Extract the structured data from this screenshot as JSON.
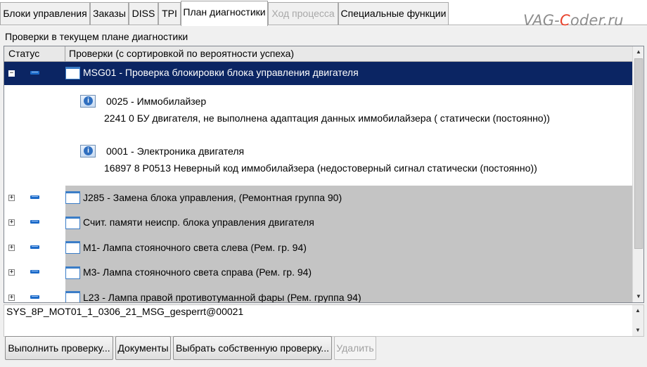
{
  "tabs": [
    {
      "label": "Блоки управления",
      "state": "normal"
    },
    {
      "label": "Заказы",
      "state": "normal"
    },
    {
      "label": "DISS",
      "state": "normal"
    },
    {
      "label": "TPI",
      "state": "normal"
    },
    {
      "label": "План диагностики",
      "state": "active"
    },
    {
      "label": "Ход процесса",
      "state": "disabled"
    },
    {
      "label": "Специальные функции",
      "state": "normal"
    }
  ],
  "watermark": {
    "prefix": "VAG-",
    "accent": "C",
    "suffix": "oder.ru"
  },
  "plan": {
    "section_label": "Проверки в текущем плане диагностики",
    "columns": {
      "status": "Статус",
      "checks": "Проверки (с сортировкой по вероятности успеха)"
    },
    "selected_check": {
      "expander": "−",
      "label": "MSG01 - Проверка блокировки блока управления двигателя"
    },
    "details": [
      {
        "title": "0025 - Иммобилайзер",
        "text": "2241   0   БУ двигателя, не выполнена адаптация данных иммобилайзера  (    статически (постоянно))"
      },
      {
        "title": "0001 - Электроника двигателя",
        "text": "16897   8   P0513   Неверный код иммобилайзера  (недостоверный сигнал    статически (постоянно))"
      }
    ],
    "checks": [
      {
        "expander": "+",
        "label": "J285 - Замена блока управления, (Ремонтная группа 90)"
      },
      {
        "expander": "+",
        "label": "Счит. памяти неиспр. блока управления двигателя"
      },
      {
        "expander": "+",
        "label": "M1- Лампа стояночного света слева (Рем. гр. 94)"
      },
      {
        "expander": "+",
        "label": "M3- Лампа стояночного света справа (Рем. гр. 94)"
      },
      {
        "expander": "+",
        "label": "L23 - Лампа правой противотуманной фары (Рем. группа 94)"
      }
    ]
  },
  "status_line": "SYS_8P_MOT01_1_0306_21_MSG_gesperrt@00021",
  "buttons": {
    "run": "Выполнить проверку...",
    "documents": "Документы",
    "choose": "Выбрать собственную проверку...",
    "delete": "Удалить"
  },
  "colors": {
    "selection": "#0b2563",
    "row_gray": "#c4c4c4",
    "status_icon": "#1d6bc9",
    "logo_accent": "#e8442e"
  }
}
